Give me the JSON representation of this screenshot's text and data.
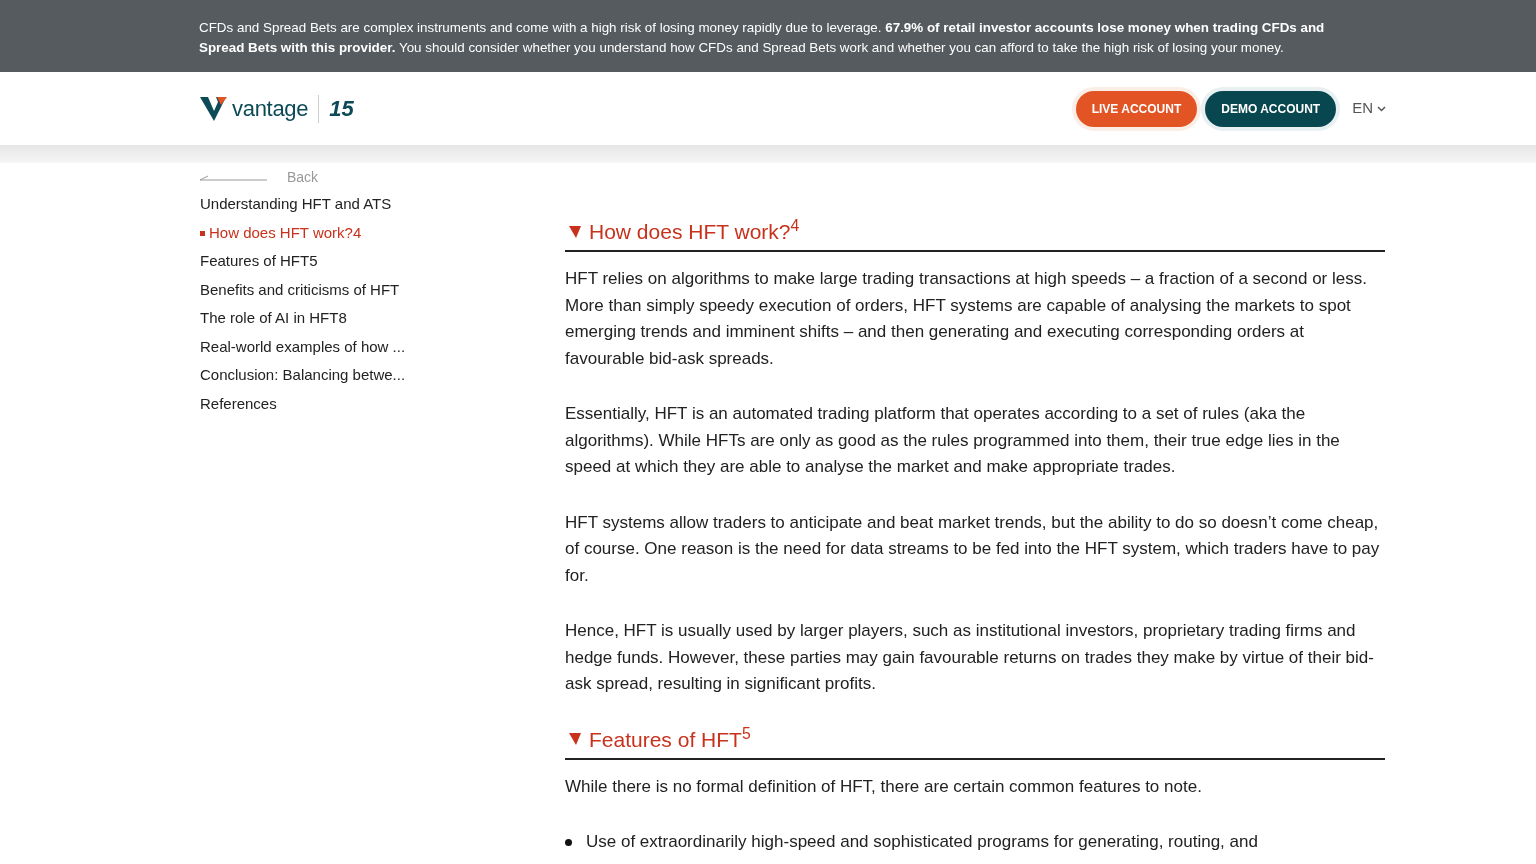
{
  "risk_banner": "CFDs and Spread Bets are complex instruments and come with a high risk of losing money rapidly due to leverage. **67.9% of retail investor accounts lose money when trading CFDs and Spread Bets with this provider.** You should consider whether you understand how CFDs and Spread Bets work and whether you can afford to take the high risk of losing your money.",
  "header": {
    "logo_text": "vantage",
    "anniversary": "15",
    "buttons": [
      {
        "label": "LIVE ACCOUNT",
        "kind": "primary"
      },
      {
        "label": "DEMO ACCOUNT",
        "kind": "secondary"
      }
    ],
    "language": "EN"
  },
  "back_link": "Back",
  "toc": [
    {
      "label": "Understanding HFT and ATS",
      "selected": false
    },
    {
      "label": "How does HFT work?4",
      "selected": true
    },
    {
      "label": "Features of HFT5",
      "selected": false
    },
    {
      "label": "Benefits and criticisms of HFT",
      "selected": false
    },
    {
      "label": "The role of AI in HFT8",
      "selected": false
    },
    {
      "label": "Real-world examples of how ...",
      "selected": false
    },
    {
      "label": "Conclusion: Balancing betwe...",
      "selected": false
    },
    {
      "label": "References",
      "selected": false
    }
  ],
  "sections": [
    {
      "heading": "How does HFT work?$^{4}$",
      "paragraphs": [
        "HFT relies on algorithms to make large trading transactions at high speeds – a fraction of a second or less. More than simply speedy execution of orders, HFT systems are capable of analysing the markets to spot emerging trends and imminent shifts – and then generating and executing corresponding orders at favourable bid-ask spreads.",
        "Essentially, HFT is an automated trading platform that operates according to a set of rules (aka the algorithms). While HFTs are only as good as the rules programmed into them, their true edge lies in the speed at which they are able to analyse the market and make appropriate trades.",
        "HFT systems allow traders to anticipate and beat market trends, but the ability to do so doesn’t come cheap, of course. One reason is the need for data streams to be fed into the HFT system, which traders have to pay for.",
        "Hence, HFT is usually used by larger players, such as institutional investors, proprietary trading firms and hedge funds. However, these parties may gain favourable returns on trades they make by virtue of their bid-ask spread, resulting in significant profits."
      ]
    },
    {
      "heading": "Features of HFT$^{5}$",
      "paragraphs": [
        "While there is no formal definition of HFT, there are certain common features to note."
      ],
      "bullets": [
        "Use of extraordinarily high-speed and sophisticated programs for generating, routing, and"
      ]
    }
  ]
}
